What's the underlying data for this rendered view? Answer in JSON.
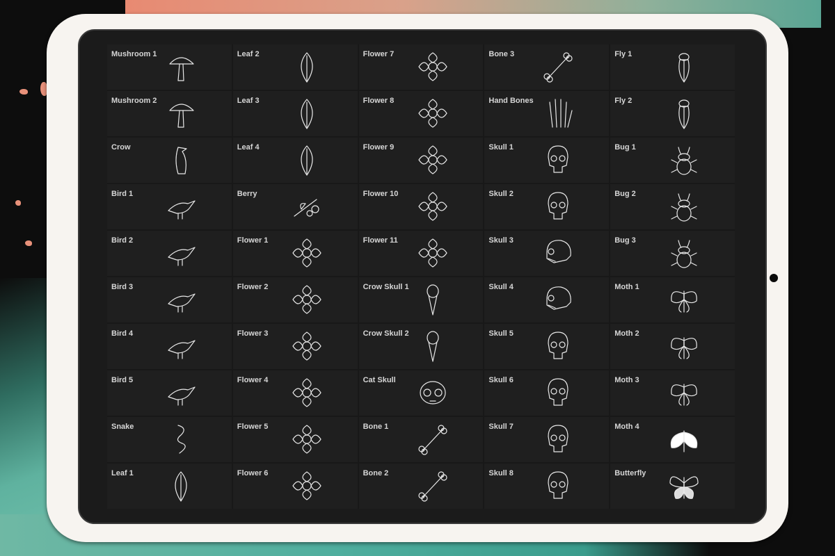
{
  "brush_library": {
    "columns": [
      {
        "items": [
          {
            "label": "Mushroom 1",
            "icon": "mushroom-icon"
          },
          {
            "label": "Mushroom 2",
            "icon": "mushroom-icon"
          },
          {
            "label": "Crow",
            "icon": "crow-icon"
          },
          {
            "label": "Bird 1",
            "icon": "bird-icon"
          },
          {
            "label": "Bird 2",
            "icon": "bird-icon"
          },
          {
            "label": "Bird 3",
            "icon": "bird-icon"
          },
          {
            "label": "Bird 4",
            "icon": "bird-icon"
          },
          {
            "label": "Bird 5",
            "icon": "bird-icon"
          },
          {
            "label": "Snake",
            "icon": "snake-icon"
          },
          {
            "label": "Leaf 1",
            "icon": "leaf-icon"
          }
        ]
      },
      {
        "items": [
          {
            "label": "Leaf 2",
            "icon": "leaf-icon"
          },
          {
            "label": "Leaf 3",
            "icon": "leaf-icon"
          },
          {
            "label": "Leaf 4",
            "icon": "leaf-icon"
          },
          {
            "label": "Berry",
            "icon": "berry-icon"
          },
          {
            "label": "Flower 1",
            "icon": "flower-icon"
          },
          {
            "label": "Flower 2",
            "icon": "flower-icon"
          },
          {
            "label": "Flower 3",
            "icon": "flower-icon"
          },
          {
            "label": "Flower 4",
            "icon": "flower-icon"
          },
          {
            "label": "Flower 5",
            "icon": "flower-icon"
          },
          {
            "label": "Flower 6",
            "icon": "flower-icon"
          }
        ]
      },
      {
        "items": [
          {
            "label": "Flower 7",
            "icon": "flower-icon"
          },
          {
            "label": "Flower 8",
            "icon": "flower-icon"
          },
          {
            "label": "Flower 9",
            "icon": "flower-icon"
          },
          {
            "label": "Flower 10",
            "icon": "flower-icon"
          },
          {
            "label": "Flower 11",
            "icon": "flower-icon"
          },
          {
            "label": "Crow Skull 1",
            "icon": "bird-skull-icon"
          },
          {
            "label": "Crow Skull 2",
            "icon": "bird-skull-icon"
          },
          {
            "label": "Cat Skull",
            "icon": "cat-skull-icon"
          },
          {
            "label": "Bone 1",
            "icon": "bone-icon"
          },
          {
            "label": "Bone 2",
            "icon": "bone-icon"
          }
        ]
      },
      {
        "items": [
          {
            "label": "Bone 3",
            "icon": "bone-icon"
          },
          {
            "label": "Hand Bones",
            "icon": "hand-bones-icon"
          },
          {
            "label": "Skull 1",
            "icon": "skull-icon"
          },
          {
            "label": "Skull 2",
            "icon": "skull-icon"
          },
          {
            "label": "Skull 3",
            "icon": "skull-side-icon"
          },
          {
            "label": "Skull 4",
            "icon": "skull-side-icon"
          },
          {
            "label": "Skull 5",
            "icon": "skull-icon"
          },
          {
            "label": "Skull 6",
            "icon": "skull-icon"
          },
          {
            "label": "Skull 7",
            "icon": "skull-icon"
          },
          {
            "label": "Skull 8",
            "icon": "skull-icon"
          }
        ]
      },
      {
        "items": [
          {
            "label": "Fly 1",
            "icon": "cicada-icon"
          },
          {
            "label": "Fly 2",
            "icon": "cicada-icon"
          },
          {
            "label": "Bug 1",
            "icon": "beetle-icon"
          },
          {
            "label": "Bug 2",
            "icon": "beetle-icon"
          },
          {
            "label": "Bug 3",
            "icon": "beetle-icon"
          },
          {
            "label": "Moth 1",
            "icon": "moth-icon"
          },
          {
            "label": "Moth 2",
            "icon": "moth-icon"
          },
          {
            "label": "Moth 3",
            "icon": "moth-icon"
          },
          {
            "label": "Moth 4",
            "icon": "moth-filled-icon"
          },
          {
            "label": "Butterfly",
            "icon": "butterfly-icon"
          }
        ]
      }
    ]
  },
  "colors": {
    "screen_bg": "#1b1b1b",
    "cell_bg": "#1f1f1f",
    "label_text": "#d6d6d6",
    "tablet_frame": "#f7f4f0",
    "accent_coral": "#e8917a",
    "accent_teal": "#4fae9e"
  }
}
